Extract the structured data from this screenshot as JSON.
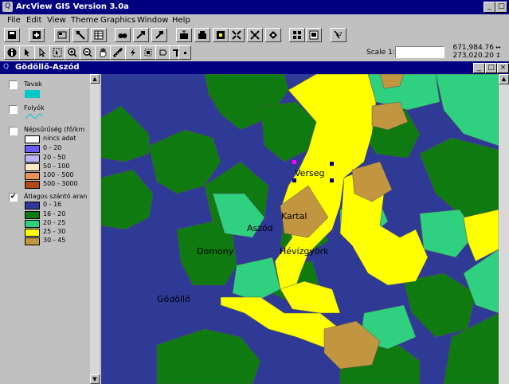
{
  "app": {
    "title": "ArcView GIS Version 3.0a",
    "icon": "arcview-logo-icon"
  },
  "menu": [
    "File",
    "Edit",
    "View",
    "Theme",
    "Graphics",
    "Window",
    "Help"
  ],
  "toolbar": {
    "scale_label": "Scale 1:",
    "scale_value": "",
    "coord_x": "671,984.76",
    "coord_y": "273,020.20"
  },
  "view": {
    "title": "Gödöllő-Aszód",
    "icon": "view-globe-icon"
  },
  "toc": {
    "themes": [
      {
        "name": "Tavak",
        "checked": false,
        "legend": [
          {
            "color": "#00c8c8",
            "label": ""
          }
        ]
      },
      {
        "name": "Folyók",
        "checked": false,
        "legend": [
          {
            "color": "line",
            "label": ""
          }
        ]
      },
      {
        "name": "Népsűrűség (fő/km",
        "checked": false,
        "legend": [
          {
            "color": "#ffffff",
            "label": "nincs adat"
          },
          {
            "color": "#6a5cff",
            "label": "0 - 20"
          },
          {
            "color": "#bdb6ff",
            "label": "20 - 50"
          },
          {
            "color": "#ffe8c8",
            "label": "50 - 100"
          },
          {
            "color": "#e8905a",
            "label": "100 - 500"
          },
          {
            "color": "#b04a18",
            "label": "500 - 3000"
          }
        ]
      },
      {
        "name": "Átlagos szántó aran",
        "checked": true,
        "legend": [
          {
            "color": "#2f3a96",
            "label": "0 - 16"
          },
          {
            "color": "#0f7a10",
            "label": "16 - 20"
          },
          {
            "color": "#2fd080",
            "label": "20 - 25"
          },
          {
            "color": "#ffff00",
            "label": "25 - 30"
          },
          {
            "color": "#c29640",
            "label": "30 - 45"
          }
        ]
      }
    ]
  },
  "map": {
    "labels": [
      "Verseg",
      "Kartal",
      "Aszód",
      "Domony",
      "Hévízgyörk",
      "Gödöllő"
    ],
    "colors": {
      "c1": "#2f3a96",
      "c2": "#0f7a10",
      "c3": "#2fd080",
      "c4": "#ffff00",
      "c5": "#c29640"
    }
  }
}
